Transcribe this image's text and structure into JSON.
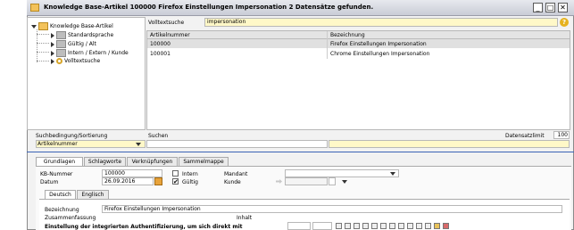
{
  "window": {
    "title": "Knowledge Base-Artikel 100000 Firefox Einstellungen Impersonation  2 Datensätze gefunden.",
    "minimize_glyph": "_",
    "maximize_glyph": "□",
    "close_glyph": "✕"
  },
  "tree": {
    "root": "Knowledge Base-Artikel",
    "items": [
      "Standardsprache",
      "Gültig / Alt",
      "Intern / Extern / Kunde",
      "Volltextsuche"
    ]
  },
  "search": {
    "label": "Volltextsuche",
    "value": "impersonation",
    "help_icon": "?"
  },
  "grid": {
    "columns": [
      "Artikelnummer",
      "Bezeichnung"
    ],
    "rows": [
      [
        "100000",
        "Firefox Einstellungen Impersonation"
      ],
      [
        "100001",
        "Chrome Einstellungen Impersonation"
      ]
    ]
  },
  "filter": {
    "condition_label": "Suchbedingung/Sortierung",
    "condition_value": "Artikelnummer",
    "search_label": "Suchen",
    "count_label": "Datensatzlimit",
    "count_value": "100"
  },
  "tabs": [
    "Grundlagen",
    "Schlagworte",
    "Verknüpfungen",
    "Sammelmappe"
  ],
  "form": {
    "kb_label": "KB-Nummer",
    "kb_value": "100000",
    "date_label": "Datum",
    "date_value": "26.09.2016",
    "intern_label": "Intern",
    "valid_label": "Gültig",
    "valid_checked": "✔",
    "client_label": "Mandant",
    "customer_label": "Kunde"
  },
  "lang_tabs": [
    "Deutsch",
    "Englisch"
  ],
  "detail": {
    "name_label": "Bezeichnung",
    "name_value": "Firefox Einstellungen Impersonation",
    "summary_label": "Zusammenfassung",
    "content_label": "Inhalt",
    "summary_text": "Einstellung der integrierten Authentifizierung, um sich direkt mit"
  }
}
